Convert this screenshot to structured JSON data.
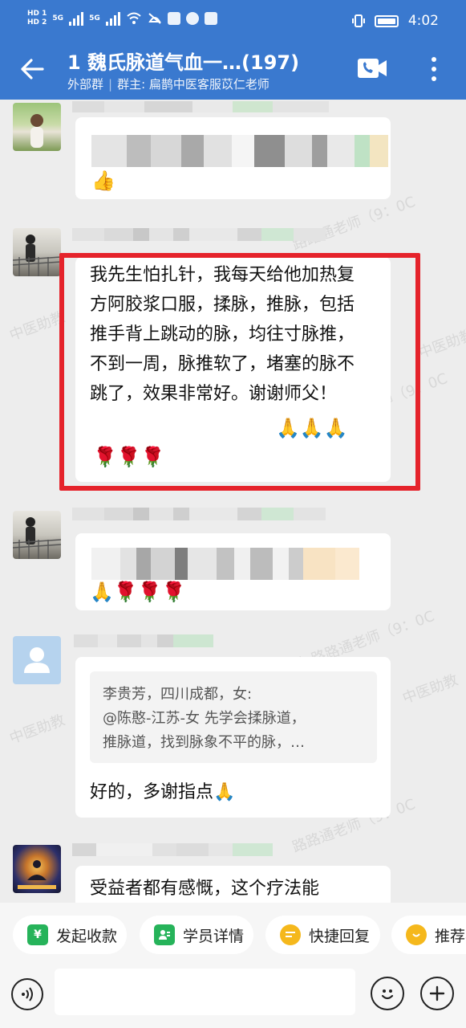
{
  "status": {
    "time": "4:02",
    "hd1": "HD 1",
    "hd2": "HD 2",
    "net1": "5G",
    "net2": "5G"
  },
  "header": {
    "title": "1 魏氏脉道气血一…(197)",
    "group_type": "外部群",
    "owner": "群主: 扁鹊中医客服苡仁老师"
  },
  "messages": [
    {
      "id": "m1",
      "emoji": "👍"
    },
    {
      "id": "m2",
      "text": "我先生怕扎针，我每天给他加热复方阿胶浆口服，揉脉，推脉，包括推手背上跳动的脉，均往寸脉推，不到一周，脉推软了，堵塞的脉不跳了，效果非常好。谢谢师父！",
      "emoji_line1": "🙏🙏🙏",
      "emoji_line2": "🌹🌹🌹"
    },
    {
      "id": "m3",
      "emoji": "🙏🌹🌹🌹"
    },
    {
      "id": "m4",
      "quote_line1": "李贵芳，四川成都，女:",
      "quote_line2": "@陈憨-江苏-女 先学会揉脉道，",
      "quote_line3": "推脉道，找到脉象不平的脉，…",
      "text": "好的，多谢指点🙏"
    },
    {
      "id": "m5",
      "text": "受益者都有感慨，这个疗法能"
    }
  ],
  "watermarks": [
    "路路通老师（9：0C",
    "中医助教",
    "中医助教",
    "路路通老师（9：0C",
    "教-路路通老师（9：0C",
    "中医助教",
    "中医助教",
    "路路通老师（9：0C"
  ],
  "quick_actions": [
    {
      "label": "发起收款",
      "icon": "yen-icon",
      "color": "#26b35a"
    },
    {
      "label": "学员详情",
      "icon": "user-card-icon",
      "color": "#26b35a"
    },
    {
      "label": "快捷回复",
      "icon": "quick-reply-icon",
      "color": "#f5b81c"
    },
    {
      "label": "推荐客",
      "icon": "recommend-icon",
      "color": "#f5b81c"
    }
  ],
  "colors": {
    "header_bg": "#3a79cf",
    "highlight_border": "#e5232b"
  }
}
